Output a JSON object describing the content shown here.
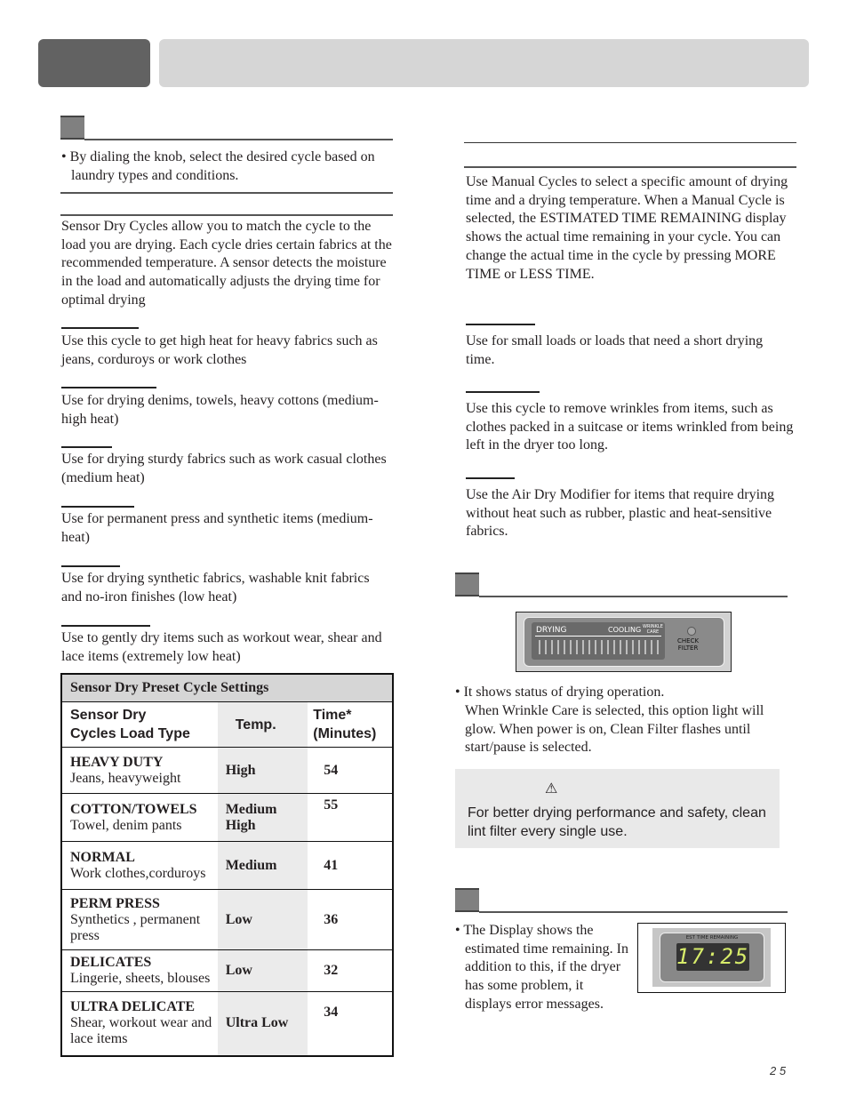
{
  "header": {
    "tab_dark": "",
    "tab_light": ""
  },
  "left": {
    "intro_bullet": "• By dialing the knob, select the desired cycle based on laundry types and conditions.",
    "sensor_intro": "Sensor Dry Cycles allow you to match the cycle to the load you are drying. Each cycle dries certain fabrics at the recommended temperature. A sensor detects the moisture in the load and automatically adjusts the drying time for optimal drying",
    "cycles": [
      {
        "desc": "Use this cycle to get high heat for heavy fabrics such as jeans, corduroys or work clothes"
      },
      {
        "desc": "Use for drying denims, towels, heavy cottons (medium-high heat)"
      },
      {
        "desc": "Use for drying sturdy fabrics such as work casual clothes (medium heat)"
      },
      {
        "desc": "Use for permanent press and synthetic items (medium-heat)"
      },
      {
        "desc": "Use for drying synthetic fabrics, washable knit fabrics and no-iron finishes (low heat)"
      },
      {
        "desc": "Use to gently dry items such as workout wear, shear and lace items (extremely low heat)"
      }
    ]
  },
  "table": {
    "caption": "Sensor Dry Preset Cycle Settings",
    "headers": {
      "load": "Sensor Dry Cycles Load Type",
      "load_l1": "Sensor Dry",
      "load_l2": "Cycles Load Type",
      "temp": "Temp.",
      "time_l1": "Time*",
      "time_l2": "(Minutes)"
    },
    "rows": [
      {
        "name": "HEAVY DUTY",
        "load": "Jeans, heavyweight",
        "temp": "High",
        "time": "54"
      },
      {
        "name": "COTTON/TOWELS",
        "load": "Towel, denim pants",
        "temp": "Medium High",
        "time": "55"
      },
      {
        "name": "NORMAL",
        "load": "Work clothes,corduroys",
        "temp": "Medium",
        "time": "41"
      },
      {
        "name": "PERM PRESS",
        "load": "Synthetics , permanent press",
        "temp": "Low",
        "time": "36"
      },
      {
        "name": "DELICATES",
        "load": "Lingerie, sheets, blouses",
        "temp": "Low",
        "time": "32"
      },
      {
        "name": "ULTRA DELICATE",
        "load": "Shear, workout wear and lace items",
        "temp": "Ultra Low",
        "time": "34"
      }
    ]
  },
  "right": {
    "manual_intro": "Use Manual Cycles to select a specific amount of drying time and a drying temperature. When a Manual Cycle is selected, the ESTIMATED TIME REMAINING display shows the actual time remaining in your cycle. You can change the actual time in the cycle by pressing MORE TIME or LESS TIME.",
    "manual_cycles": [
      {
        "desc": "Use for small loads or loads that need a short drying time."
      },
      {
        "desc": "Use this cycle to remove wrinkles from items, such as clothes packed in a suitcase or items wrinkled from being left in the dryer too long."
      },
      {
        "desc": "Use the Air Dry Modifier for items that require drying without heat such as rubber, plastic and heat-sensitive fabrics."
      }
    ],
    "status_panel": {
      "drying": "DRYING",
      "cooling": "COOLING",
      "wrinkle_care_l1": "WRINKLE",
      "wrinkle_care_l2": "CARE",
      "check_l1": "CHECK",
      "check_l2": "FILTER"
    },
    "status_bullet_l1": "• It shows status of drying operation.",
    "status_bullet_rest": "When Wrinkle Care is selected, this option light will glow. When power is on, Clean Filter flashes until start/pause is selected.",
    "warning": {
      "icon": "⚠",
      "text": "For better drying performance and safety, clean lint filter every single use."
    },
    "time_bullet": "• The Display shows the estimated time remaining. In addition to this, if the dryer has some problem, it displays error messages.",
    "time_display": {
      "label": "EST TIME REMAINING",
      "value": "17:25"
    }
  },
  "footer": {
    "page_number": "2 5"
  }
}
